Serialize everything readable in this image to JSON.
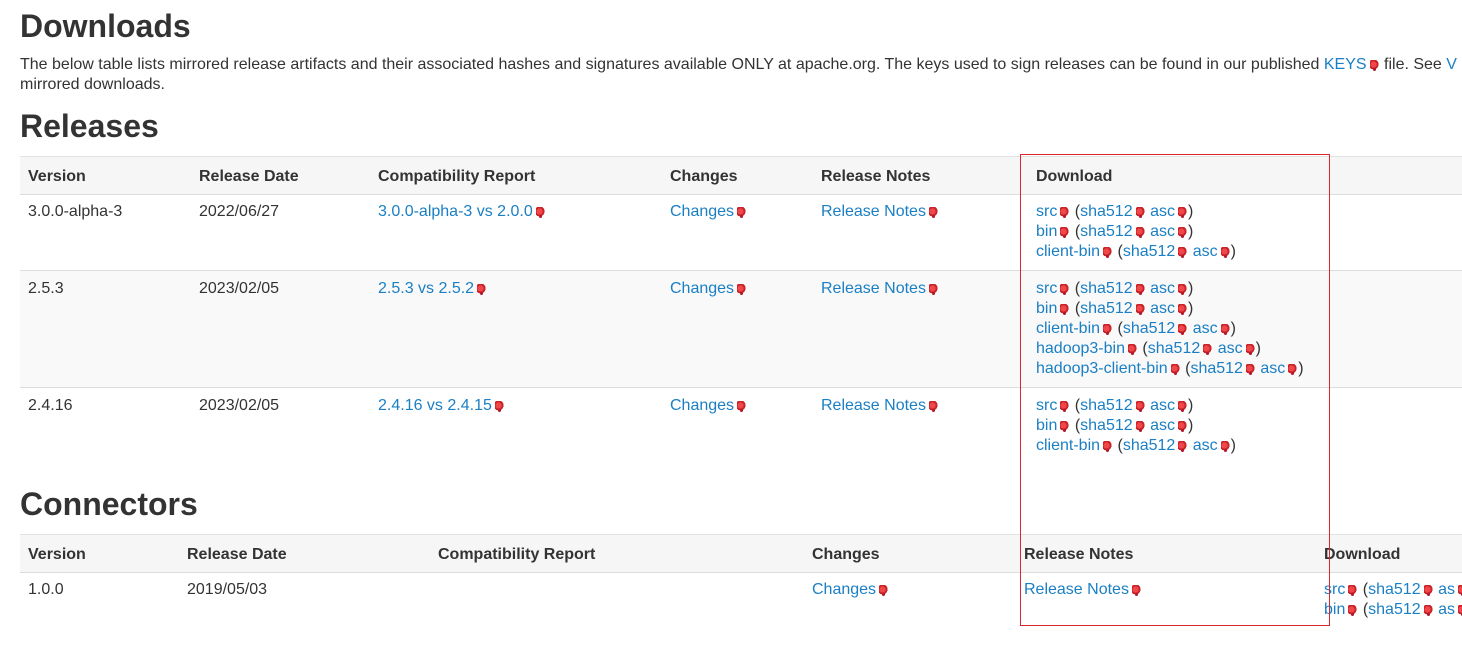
{
  "page": {
    "downloads_heading": "Downloads",
    "intro_text": "The below table lists mirrored release artifacts and their associated hashes and signatures available ONLY at apache.org. The keys used to sign releases can be found in our published ",
    "intro_keys_link": "KEYS",
    "intro_text_after": " file. See ",
    "intro_trailing_link": "V",
    "intro_text_line2": "mirrored downloads.",
    "releases_heading": "Releases",
    "connectors_heading": "Connectors"
  },
  "releases_table": {
    "headers": [
      "Version",
      "Release Date",
      "Compatibility Report",
      "Changes",
      "Release Notes",
      "Download"
    ],
    "rows": [
      {
        "version": "3.0.0-alpha-3",
        "date": "2022/06/27",
        "compat": "3.0.0-alpha-3 vs 2.0.0",
        "changes": "Changes",
        "notes": "Release Notes",
        "downloads": [
          {
            "name": "src",
            "sha": "sha512",
            "asc": "asc"
          },
          {
            "name": "bin",
            "sha": "sha512",
            "asc": "asc"
          },
          {
            "name": "client-bin",
            "sha": "sha512",
            "asc": "asc"
          }
        ]
      },
      {
        "version": "2.5.3",
        "date": "2023/02/05",
        "compat": "2.5.3 vs 2.5.2",
        "changes": "Changes",
        "notes": "Release Notes",
        "downloads": [
          {
            "name": "src",
            "sha": "sha512",
            "asc": "asc"
          },
          {
            "name": "bin",
            "sha": "sha512",
            "asc": "asc"
          },
          {
            "name": "client-bin",
            "sha": "sha512",
            "asc": "asc"
          },
          {
            "name": "hadoop3-bin",
            "sha": "sha512",
            "asc": "asc"
          },
          {
            "name": "hadoop3-client-bin",
            "sha": "sha512",
            "asc": "asc"
          }
        ]
      },
      {
        "version": "2.4.16",
        "date": "2023/02/05",
        "compat": "2.4.16 vs 2.4.15",
        "changes": "Changes",
        "notes": "Release Notes",
        "downloads": [
          {
            "name": "src",
            "sha": "sha512",
            "asc": "asc"
          },
          {
            "name": "bin",
            "sha": "sha512",
            "asc": "asc"
          },
          {
            "name": "client-bin",
            "sha": "sha512",
            "asc": "asc"
          }
        ]
      }
    ]
  },
  "connectors_table": {
    "headers": [
      "Version",
      "Release Date",
      "Compatibility Report",
      "Changes",
      "Release Notes",
      "Download"
    ],
    "rows": [
      {
        "version": "1.0.0",
        "date": "2019/05/03",
        "compat": "",
        "changes": "Changes",
        "notes": "Release Notes",
        "downloads": [
          {
            "name": "src",
            "sha": "sha512",
            "asc": "as"
          },
          {
            "name": "bin",
            "sha": "sha512",
            "asc": "as"
          }
        ]
      }
    ]
  },
  "symbols": {
    "open_paren": "(",
    "close_paren": ")",
    "space": " "
  },
  "icons": {
    "external_link": "external-link-icon"
  },
  "colors": {
    "link": "#1a7fc4",
    "highlight_box": "#d9262f",
    "header_bg": "#f6f6f6"
  }
}
